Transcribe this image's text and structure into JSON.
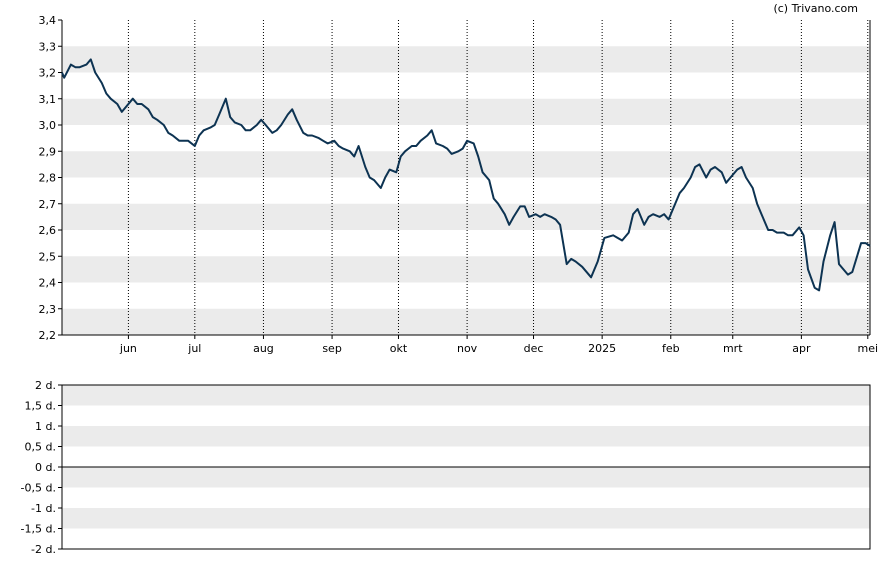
{
  "copyright": "(c) Trivano.com",
  "colors": {
    "band": "#ebebeb",
    "line": "#0d3352",
    "axis": "#000000"
  },
  "chart_data": [
    {
      "type": "line",
      "ylim": [
        2.2,
        3.4
      ],
      "yticks": [
        {
          "v": 2.2,
          "label": "2,2"
        },
        {
          "v": 2.3,
          "label": "2,3"
        },
        {
          "v": 2.4,
          "label": "2,4"
        },
        {
          "v": 2.5,
          "label": "2,5"
        },
        {
          "v": 2.6,
          "label": "2,6"
        },
        {
          "v": 2.7,
          "label": "2,7"
        },
        {
          "v": 2.8,
          "label": "2,8"
        },
        {
          "v": 2.9,
          "label": "2,9"
        },
        {
          "v": 3.0,
          "label": "3,0"
        },
        {
          "v": 3.1,
          "label": "3,1"
        },
        {
          "v": 3.2,
          "label": "3,2"
        },
        {
          "v": 3.3,
          "label": "3,3"
        },
        {
          "v": 3.4,
          "label": "3,4"
        }
      ],
      "xlim": [
        "2024-05-02",
        "2025-05-02"
      ],
      "xticks": [
        {
          "date": "2024-06-01",
          "label": "jun"
        },
        {
          "date": "2024-07-01",
          "label": "jul"
        },
        {
          "date": "2024-08-01",
          "label": "aug"
        },
        {
          "date": "2024-09-01",
          "label": "sep"
        },
        {
          "date": "2024-10-01",
          "label": "okt"
        },
        {
          "date": "2024-11-01",
          "label": "nov"
        },
        {
          "date": "2024-12-01",
          "label": "dec"
        },
        {
          "date": "2025-01-01",
          "label": "2025"
        },
        {
          "date": "2025-02-01",
          "label": "feb"
        },
        {
          "date": "2025-03-01",
          "label": "mrt"
        },
        {
          "date": "2025-04-01",
          "label": "apr"
        },
        {
          "date": "2025-05-01",
          "label": "mei"
        }
      ],
      "grid": "vertical-dotted",
      "series": [
        {
          "x": [
            "2024-05-02",
            "2024-05-03",
            "2024-05-06",
            "2024-05-08",
            "2024-05-10",
            "2024-05-13",
            "2024-05-15",
            "2024-05-17",
            "2024-05-20",
            "2024-05-22",
            "2024-05-24",
            "2024-05-27",
            "2024-05-29",
            "2024-05-31",
            "2024-06-03",
            "2024-06-05",
            "2024-06-07",
            "2024-06-10",
            "2024-06-12",
            "2024-06-14",
            "2024-06-17",
            "2024-06-19",
            "2024-06-21",
            "2024-06-24",
            "2024-06-26",
            "2024-06-28",
            "2024-07-01",
            "2024-07-03",
            "2024-07-05",
            "2024-07-08",
            "2024-07-10",
            "2024-07-12",
            "2024-07-15",
            "2024-07-17",
            "2024-07-19",
            "2024-07-22",
            "2024-07-24",
            "2024-07-26",
            "2024-07-29",
            "2024-07-31",
            "2024-08-02",
            "2024-08-05",
            "2024-08-07",
            "2024-08-09",
            "2024-08-12",
            "2024-08-14",
            "2024-08-16",
            "2024-08-19",
            "2024-08-21",
            "2024-08-23",
            "2024-08-26",
            "2024-08-28",
            "2024-08-30",
            "2024-09-02",
            "2024-09-04",
            "2024-09-06",
            "2024-09-09",
            "2024-09-11",
            "2024-09-13",
            "2024-09-16",
            "2024-09-18",
            "2024-09-20",
            "2024-09-23",
            "2024-09-25",
            "2024-09-27",
            "2024-09-30",
            "2024-10-02",
            "2024-10-04",
            "2024-10-07",
            "2024-10-09",
            "2024-10-11",
            "2024-10-14",
            "2024-10-16",
            "2024-10-18",
            "2024-10-21",
            "2024-10-23",
            "2024-10-25",
            "2024-10-28",
            "2024-10-30",
            "2024-11-01",
            "2024-11-04",
            "2024-11-06",
            "2024-11-08",
            "2024-11-11",
            "2024-11-13",
            "2024-11-15",
            "2024-11-18",
            "2024-11-20",
            "2024-11-22",
            "2024-11-25",
            "2024-11-27",
            "2024-11-29",
            "2024-12-02",
            "2024-12-04",
            "2024-12-06",
            "2024-12-09",
            "2024-12-11",
            "2024-12-13",
            "2024-12-16",
            "2024-12-18",
            "2024-12-20",
            "2024-12-23",
            "2024-12-27",
            "2024-12-30",
            "2025-01-02",
            "2025-01-06",
            "2025-01-08",
            "2025-01-10",
            "2025-01-13",
            "2025-01-15",
            "2025-01-17",
            "2025-01-20",
            "2025-01-22",
            "2025-01-24",
            "2025-01-27",
            "2025-01-29",
            "2025-01-31",
            "2025-02-03",
            "2025-02-05",
            "2025-02-07",
            "2025-02-10",
            "2025-02-12",
            "2025-02-14",
            "2025-02-17",
            "2025-02-19",
            "2025-02-21",
            "2025-02-24",
            "2025-02-26",
            "2025-02-28",
            "2025-03-03",
            "2025-03-05",
            "2025-03-07",
            "2025-03-10",
            "2025-03-12",
            "2025-03-14",
            "2025-03-17",
            "2025-03-19",
            "2025-03-21",
            "2025-03-24",
            "2025-03-26",
            "2025-03-28",
            "2025-03-31",
            "2025-04-02",
            "2025-04-04",
            "2025-04-07",
            "2025-04-09",
            "2025-04-11",
            "2025-04-14",
            "2025-04-16",
            "2025-04-18",
            "2025-04-22",
            "2025-04-24",
            "2025-04-28",
            "2025-04-30",
            "2025-05-02"
          ],
          "y": [
            3.2,
            3.18,
            3.23,
            3.22,
            3.22,
            3.23,
            3.25,
            3.2,
            3.16,
            3.12,
            3.1,
            3.08,
            3.05,
            3.07,
            3.1,
            3.08,
            3.08,
            3.06,
            3.03,
            3.02,
            3.0,
            2.97,
            2.96,
            2.94,
            2.94,
            2.94,
            2.92,
            2.96,
            2.98,
            2.99,
            3.0,
            3.04,
            3.1,
            3.03,
            3.01,
            3.0,
            2.98,
            2.98,
            3.0,
            3.02,
            3.0,
            2.97,
            2.98,
            3.0,
            3.04,
            3.06,
            3.02,
            2.97,
            2.96,
            2.96,
            2.95,
            2.94,
            2.93,
            2.94,
            2.92,
            2.91,
            2.9,
            2.88,
            2.92,
            2.84,
            2.8,
            2.79,
            2.76,
            2.8,
            2.83,
            2.82,
            2.88,
            2.9,
            2.92,
            2.92,
            2.94,
            2.96,
            2.98,
            2.93,
            2.92,
            2.91,
            2.89,
            2.9,
            2.91,
            2.94,
            2.93,
            2.88,
            2.82,
            2.79,
            2.72,
            2.7,
            2.66,
            2.62,
            2.65,
            2.69,
            2.69,
            2.65,
            2.66,
            2.65,
            2.66,
            2.65,
            2.64,
            2.62,
            2.47,
            2.49,
            2.48,
            2.46,
            2.42,
            2.48,
            2.57,
            2.58,
            2.57,
            2.56,
            2.59,
            2.66,
            2.68,
            2.62,
            2.65,
            2.66,
            2.65,
            2.66,
            2.64,
            2.7,
            2.74,
            2.76,
            2.8,
            2.84,
            2.85,
            2.8,
            2.83,
            2.84,
            2.82,
            2.78,
            2.8,
            2.83,
            2.84,
            2.8,
            2.76,
            2.7,
            2.66,
            2.6,
            2.6,
            2.59,
            2.59,
            2.58,
            2.58,
            2.61,
            2.58,
            2.45,
            2.38,
            2.37,
            2.48,
            2.58,
            2.63,
            2.47,
            2.43,
            2.44,
            2.55,
            2.55,
            2.54
          ]
        }
      ]
    },
    {
      "type": "line",
      "ylim": [
        -2,
        2
      ],
      "yticks": [
        {
          "v": 2,
          "label": "2 d."
        },
        {
          "v": 1.5,
          "label": "1,5 d."
        },
        {
          "v": 1,
          "label": "1 d."
        },
        {
          "v": 0.5,
          "label": "0,5 d."
        },
        {
          "v": 0,
          "label": "0 d."
        },
        {
          "v": -0.5,
          "label": "-0,5 d."
        },
        {
          "v": -1,
          "label": "-1 d."
        },
        {
          "v": -1.5,
          "label": "-1,5 d."
        },
        {
          "v": -2,
          "label": "-2 d."
        }
      ],
      "baseline": 0,
      "series": []
    }
  ]
}
